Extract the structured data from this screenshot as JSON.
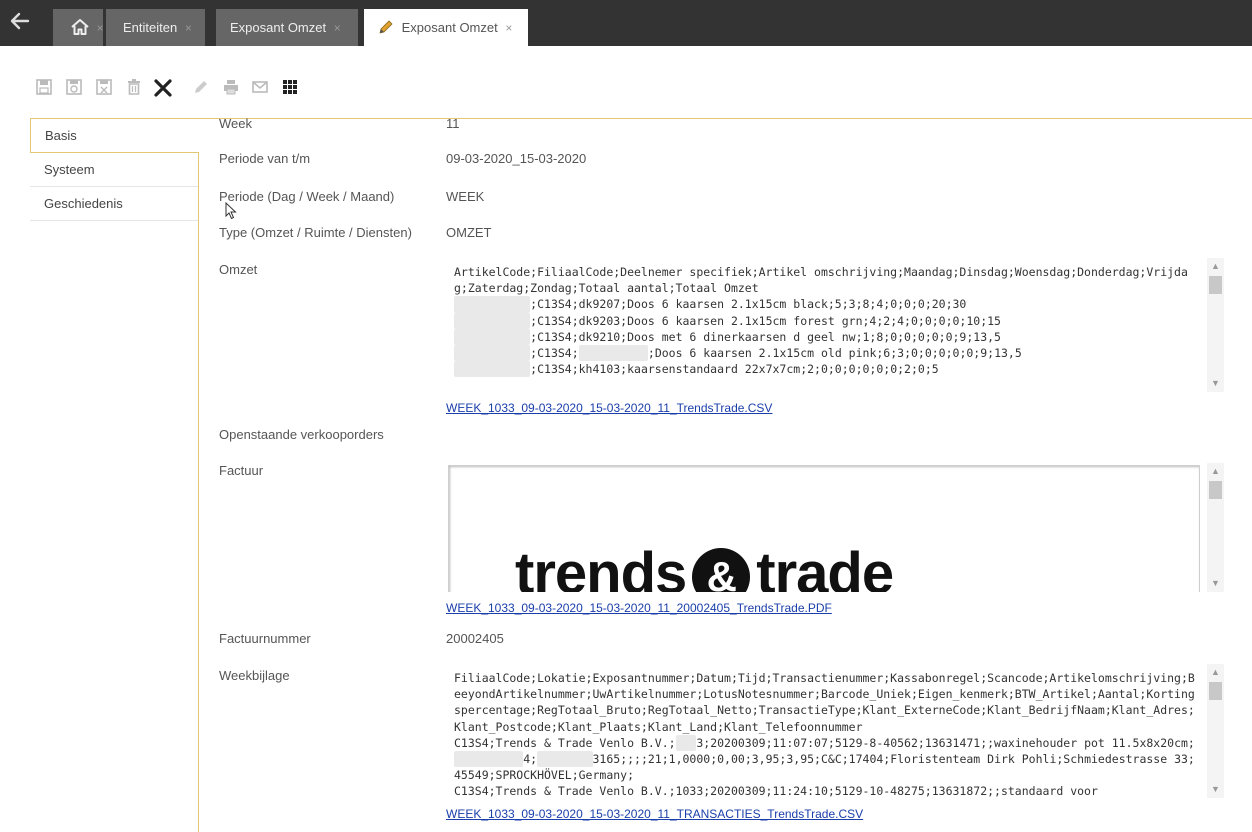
{
  "tabs": {
    "home_close": "×",
    "entiteiten": "Entiteiten",
    "entiteiten_close": "×",
    "exposant1": "Exposant Omzet",
    "exposant1_close": "×",
    "exposant2": "Exposant Omzet",
    "exposant2_close": "×"
  },
  "sidebar": {
    "items": [
      {
        "label": "Basis"
      },
      {
        "label": "Systeem"
      },
      {
        "label": "Geschiedenis"
      }
    ]
  },
  "fields": {
    "week_label": "Week",
    "week_value": "11",
    "periode_label": "Periode van t/m",
    "periode_value": "09-03-2020_15-03-2020",
    "periodetype_label": "Periode (Dag / Week / Maand)",
    "periodetype_value": "WEEK",
    "type_label": "Type (Omzet / Ruimte / Diensten)",
    "type_value": "OMZET",
    "omzet_label": "Omzet",
    "omzet_link": "WEEK_1033_09-03-2020_15-03-2020_11_TrendsTrade.CSV",
    "openstaande_label": "Openstaande verkooporders",
    "factuur_label": "Factuur",
    "factuur_logo_left": "trends",
    "factuur_logo_amp": "&",
    "factuur_logo_right": "trade",
    "factuur_link": "WEEK_1033_09-03-2020_15-03-2020_11_20002405_TrendsTrade.PDF",
    "factuurnummer_label": "Factuurnummer",
    "factuurnummer_value": "20002405",
    "weekbijlage_label": "Weekbijlage",
    "weekbijlage_link": "WEEK_1033_09-03-2020_15-03-2020_11_TRANSACTIES_TrendsTrade.CSV"
  },
  "omzet_text": {
    "header": "ArtikelCode;FiliaalCode;Deelnemer specifiek;Artikel omschrijving;Maandag;Dinsdag;Woensdag;Donderdag;Vrijdag;Zaterdag;Zondag;Totaal aantal;Totaal Omzet",
    "row1": ";C13S4;dk9207;Doos 6 kaarsen 2.1x15cm black;5;3;8;4;0;0;0;20;30",
    "row2": ";C13S4;dk9203;Doos 6 kaarsen 2.1x15cm forest grn;4;2;4;0;0;0;0;10;15",
    "row3": ";C13S4;dk9210;Doos met 6 dinerkaarsen d geel nw;1;8;0;0;0;0;0;9;13,5",
    "row4": ";C13S4;",
    "row4b": ";Doos 6 kaarsen 2.1x15cm old pink;6;3;0;0;0;0;0;9;13,5",
    "row5": ";C13S4;kh4103;kaarsenstandaard 22x7x7cm;2;0;0;0;0;0;0;2;0;5"
  },
  "week_text": {
    "header": "FiliaalCode;Lokatie;Exposantnummer;Datum;Tijd;Transactienummer;Kassabonregel;Scancode;Artikelomschrijving;BeeyondArtikelnummer;UwArtikelnummer;LotusNotesnummer;Barcode_Uniek;Eigen_kenmerk;BTW_Artikel;Aantal;Kortingspercentage;RegTotaal_Bruto;RegTotaal_Netto;TransactieType;Klant_ExterneCode;Klant_BedrijfNaam;Klant_Adres;Klant_Postcode;Klant_Plaats;Klant_Land;Klant_Telefoonnummer",
    "row1a": "C13S4;Trends & Trade Venlo B.V.;",
    "row1b": "3;20200309;11:07:07;5129-8-40562;13631471;;waxinehouder pot 11.5x8x20cm;",
    "row1c": "4;",
    "row1d": "3165;;;;21;1,0000;0,00;3,95;3,95;C&C;17404;Floristenteam Dirk Pohli;Schmiedestrasse 33;45549;SPROCKHÖVEL;Germany;",
    "row2": "C13S4;Trends & Trade Venlo B.V.;1033;20200309;11:24:10;5129-10-48275;13631872;;standaard voor"
  }
}
